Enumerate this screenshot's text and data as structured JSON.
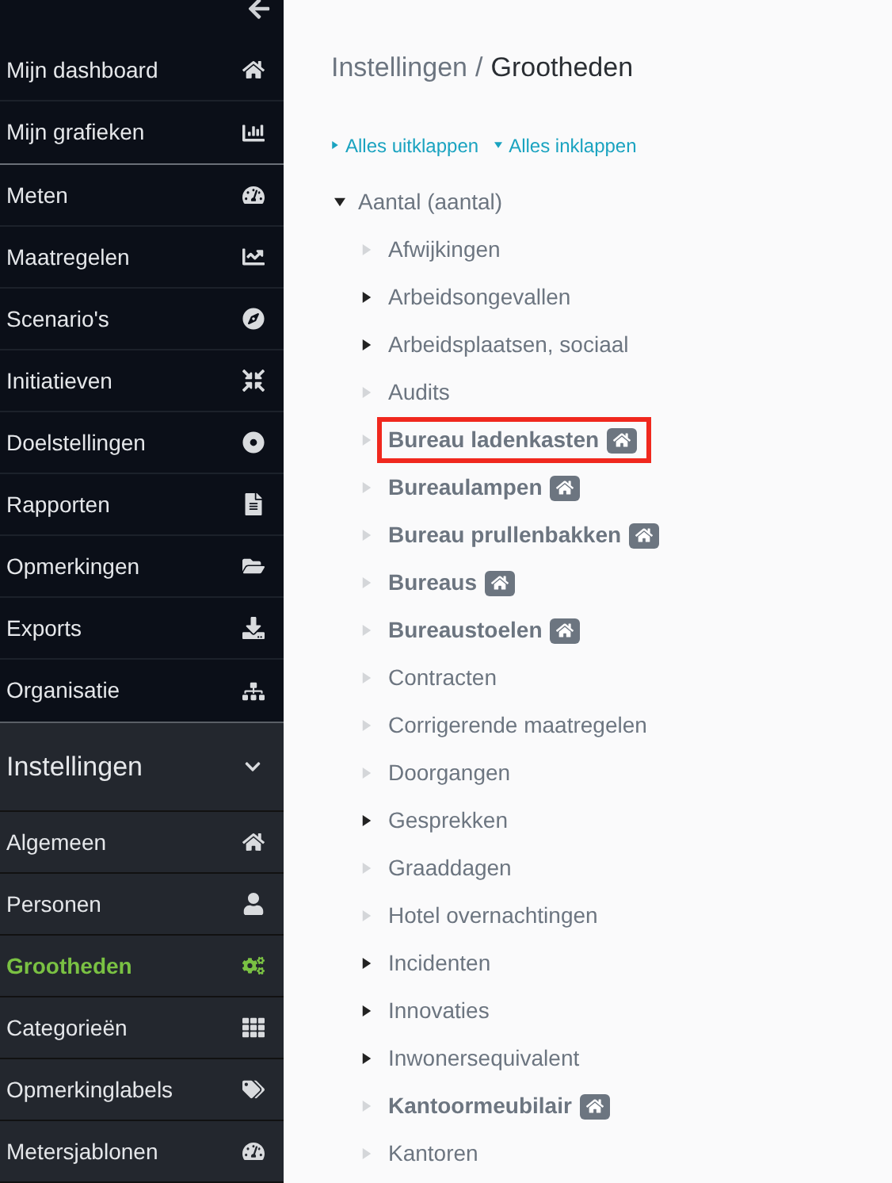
{
  "sidebar": {
    "groups": [
      [
        {
          "label": "Mijn dashboard"
        },
        {
          "label": "Mijn grafieken"
        }
      ],
      [
        {
          "label": "Meten"
        },
        {
          "label": "Maatregelen"
        },
        {
          "label": "Scenario's"
        },
        {
          "label": "Initiatieven"
        },
        {
          "label": "Doelstellingen"
        },
        {
          "label": "Rapporten"
        },
        {
          "label": "Opmerkingen"
        },
        {
          "label": "Exports"
        },
        {
          "label": "Organisatie"
        }
      ]
    ],
    "settings": {
      "label": "Instellingen",
      "expanded": true,
      "items": [
        {
          "label": "Algemeen",
          "selected": false
        },
        {
          "label": "Personen",
          "selected": false
        },
        {
          "label": "Grootheden",
          "selected": true
        },
        {
          "label": "Categorieën",
          "selected": false
        },
        {
          "label": "Opmerkinglabels",
          "selected": false
        },
        {
          "label": "Metersjablonen",
          "selected": false
        }
      ]
    }
  },
  "breadcrumb": {
    "items": [
      "Instellingen",
      "Grootheden"
    ],
    "separator": "/"
  },
  "actions": [
    "Alles uitklappen",
    "Alles inklappen"
  ],
  "tree": [
    {
      "label": "Aantal (aantal)",
      "expanded": true,
      "children": [
        {
          "label": "Afwijkingen",
          "kind": "leaf",
          "home": false,
          "highlighted": false
        },
        {
          "label": "Arbeidsongevallen",
          "kind": "group",
          "home": false,
          "highlighted": false
        },
        {
          "label": "Arbeidsplaatsen, sociaal",
          "kind": "group",
          "home": false,
          "highlighted": false
        },
        {
          "label": "Audits",
          "kind": "leaf",
          "home": false,
          "highlighted": false
        },
        {
          "label": "Bureau ladenkasten",
          "kind": "leaf",
          "home": true,
          "highlighted": true
        },
        {
          "label": "Bureaulampen",
          "kind": "leaf",
          "home": true,
          "highlighted": false
        },
        {
          "label": "Bureau prullenbakken",
          "kind": "leaf",
          "home": true,
          "highlighted": false
        },
        {
          "label": "Bureaus",
          "kind": "leaf",
          "home": true,
          "highlighted": false
        },
        {
          "label": "Bureaustoelen",
          "kind": "leaf",
          "home": true,
          "highlighted": false
        },
        {
          "label": "Contracten",
          "kind": "leaf",
          "home": false,
          "highlighted": false
        },
        {
          "label": "Corrigerende maatregelen",
          "kind": "leaf",
          "home": false,
          "highlighted": false
        },
        {
          "label": "Doorgangen",
          "kind": "leaf",
          "home": false,
          "highlighted": false
        },
        {
          "label": "Gesprekken",
          "kind": "group",
          "home": false,
          "highlighted": false
        },
        {
          "label": "Graaddagen",
          "kind": "leaf",
          "home": false,
          "highlighted": false
        },
        {
          "label": "Hotel overnachtingen",
          "kind": "leaf",
          "home": false,
          "highlighted": false
        },
        {
          "label": "Incidenten",
          "kind": "group",
          "home": false,
          "highlighted": false
        },
        {
          "label": "Innovaties",
          "kind": "group",
          "home": false,
          "highlighted": false
        },
        {
          "label": "Inwonersequivalent",
          "kind": "group",
          "home": false,
          "highlighted": false
        },
        {
          "label": "Kantoormeubilair",
          "kind": "leaf",
          "home": true,
          "highlighted": false
        },
        {
          "label": "Kantoren",
          "kind": "leaf",
          "home": false,
          "highlighted": false
        }
      ]
    }
  ]
}
